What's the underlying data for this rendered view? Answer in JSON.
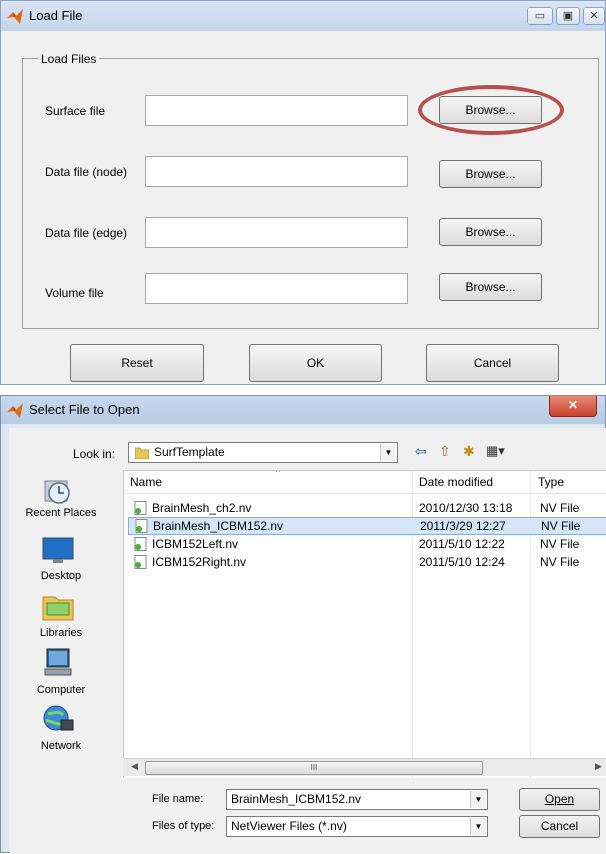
{
  "load_dialog": {
    "title": "Load File",
    "group_title": "Load Files",
    "rows": [
      {
        "label": "Surface file",
        "value": "",
        "button": "Browse..."
      },
      {
        "label": "Data file (node)",
        "value": "",
        "button": "Browse..."
      },
      {
        "label": "Data file (edge)",
        "value": "",
        "button": "Browse..."
      },
      {
        "label": "Volume file",
        "value": "",
        "button": "Browse..."
      }
    ],
    "buttons": {
      "reset": "Reset",
      "ok": "OK",
      "cancel": "Cancel"
    },
    "caption_buttons": {
      "minimize": "▭",
      "maximize": "▣",
      "close": "✕"
    },
    "highlight_color": "#b5504d"
  },
  "open_dialog": {
    "title": "Select File to Open",
    "look_in_label": "Look in:",
    "look_in_value": "SurfTemplate",
    "toolbar": {
      "back": "⇦",
      "up": "⇧",
      "new_folder": "✱",
      "view": "▦▾"
    },
    "places": [
      {
        "label": "Recent Places",
        "icon": "recent-places-icon"
      },
      {
        "label": "Desktop",
        "icon": "desktop-icon"
      },
      {
        "label": "Libraries",
        "icon": "libraries-icon"
      },
      {
        "label": "Computer",
        "icon": "computer-icon"
      },
      {
        "label": "Network",
        "icon": "network-icon"
      }
    ],
    "columns": {
      "name": "Name",
      "date": "Date modified",
      "type": "Type"
    },
    "files": [
      {
        "name": "BrainMesh_ch2.nv",
        "date": "2010/12/30 13:18",
        "type": "NV File"
      },
      {
        "name": "BrainMesh_ICBM152.nv",
        "date": "2011/3/29 12:27",
        "type": "NV File",
        "selected": true
      },
      {
        "name": "ICBM152Left.nv",
        "date": "2011/5/10 12:22",
        "type": "NV File"
      },
      {
        "name": "ICBM152Right.nv",
        "date": "2011/5/10 12:24",
        "type": "NV File"
      }
    ],
    "scroll_thumb_label": "III",
    "file_name_label": "File name:",
    "file_name_value": "BrainMesh_ICBM152.nv",
    "file_type_label": "Files of type:",
    "file_type_value": "NetViewer Files (*.nv)",
    "open_button": "Open",
    "cancel_button": "Cancel"
  }
}
